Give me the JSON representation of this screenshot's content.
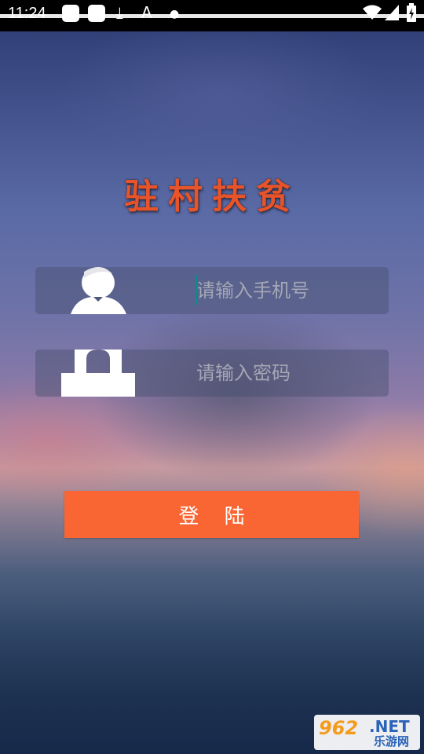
{
  "status_bar": {
    "time": "11:24",
    "icons": [
      "notification-icon",
      "notification-icon",
      "download-icon",
      "a-icon",
      "dot-icon",
      "wifi-icon",
      "signal-icon",
      "battery-icon"
    ]
  },
  "app": {
    "title": "驻村扶贫"
  },
  "login_form": {
    "phone_placeholder": "请输入手机号",
    "password_placeholder": "请输入密码",
    "login_label": "登 陆"
  },
  "watermark": {
    "number": "962",
    "domain": ".NET",
    "site": "乐游网"
  },
  "colors": {
    "title": "#e8542a",
    "button": "#fa6633",
    "field_bg": "rgba(70,80,110,0.45)"
  }
}
